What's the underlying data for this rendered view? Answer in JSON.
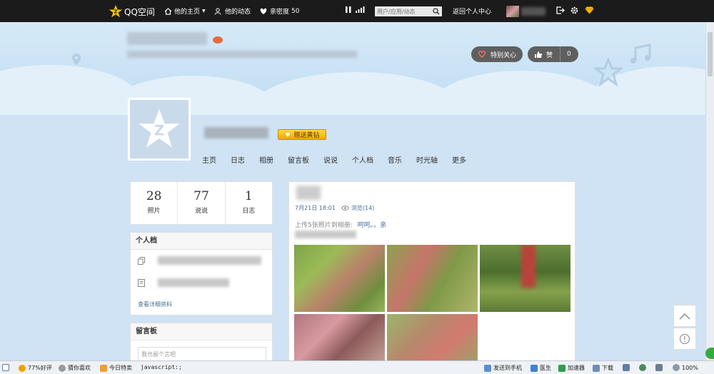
{
  "topbar": {
    "brand": "QQ空间",
    "home_label": "他的主页",
    "feeds_label": "他的动态",
    "intimacy_label": "亲密度",
    "intimacy_value": "50",
    "search_placeholder": "用户/应用/动态",
    "return_center": "返回个人中心"
  },
  "header": {
    "special_care": "特别关心",
    "like_label": "赞",
    "like_count": "0"
  },
  "profile": {
    "gift_button": "赠送黄钻"
  },
  "nav": {
    "items": [
      "主页",
      "日志",
      "相册",
      "留言板",
      "说说",
      "个人档",
      "音乐",
      "时光轴",
      "更多"
    ]
  },
  "stats": [
    {
      "num": "28",
      "label": "照片"
    },
    {
      "num": "77",
      "label": "说说"
    },
    {
      "num": "1",
      "label": "日志"
    }
  ],
  "profile_card": {
    "title": "个人档",
    "detail_link": "查看详细资料"
  },
  "guestbook": {
    "title": "留言板",
    "placeholder": "我也留个言吧"
  },
  "feed": {
    "time": "7月21日 18:01",
    "views": "浏览(14)",
    "upload_prefix": "上传5张照片到相册:",
    "album_name": "呵呵。。亲"
  },
  "statusbar": {
    "rating": "77%好评",
    "guess": "猜你喜欢",
    "daily": "今日特卖",
    "url": "javascript:;",
    "send_phone": "发送到手机",
    "doctor": "医生",
    "accelerator": "加速器",
    "download": "下载",
    "zoom": "100%"
  },
  "colors": {
    "topbar_bg": "#1b1b1b",
    "link_blue": "#4a6d9a",
    "gold": "#f0a900"
  }
}
